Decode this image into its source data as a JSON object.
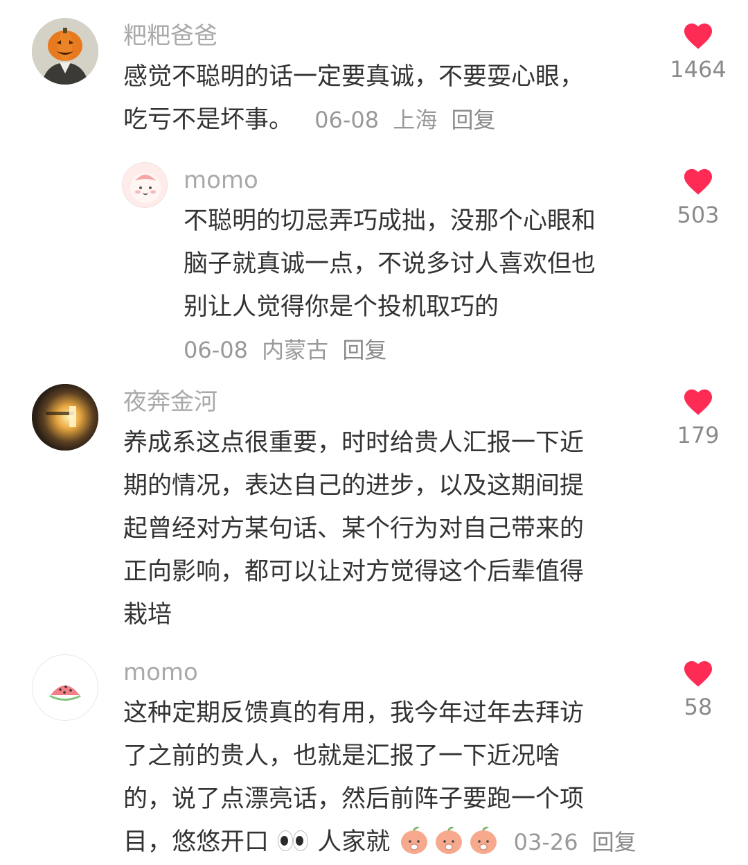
{
  "comments": [
    {
      "username": "粑粑爸爸",
      "text_lines": [
        "感觉不聪明的话一定要真诚，不要耍心眼，",
        "吃亏不是坏事。"
      ],
      "date": "06-08",
      "location": "上海",
      "reply_label": "回复",
      "likes": "1464",
      "avatar_icon": "pumpkin-head-avatar"
    },
    {
      "username": "momo",
      "text_lines": [
        "不聪明的切忌弄巧成拙，没那个心眼和",
        "脑子就真诚一点，不说多讨人喜欢但也",
        "别让人觉得你是个投机取巧的"
      ],
      "date": "06-08",
      "location": "内蒙古",
      "reply_label": "回复",
      "likes": "503",
      "avatar_icon": "pink-blob-avatar"
    },
    {
      "username": "夜奔金河",
      "text_lines": [
        "养成系这点很重要，时时给贵人汇报一下近",
        "期的情况，表达自己的进步，以及这期间提",
        "起曾经对方某句话、某个行为对自己带来的",
        "正向影响，都可以让对方觉得这个后辈值得",
        "栽培"
      ],
      "likes": "179",
      "avatar_icon": "lamp-photo-avatar"
    },
    {
      "username": "momo",
      "text_lines": [
        "这种定期反馈真的有用，我今年过年去拜访",
        "了之前的贵人，也就是汇报了一下近况啥",
        "的，说了点漂亮话，然后前阵子要跑一个项"
      ],
      "last_line": "目，悠悠开口",
      "last_line_2": "人家就",
      "date": "03-26",
      "reply_label": "回复",
      "likes": "58",
      "avatar_icon": "watermelon-avatar"
    }
  ],
  "colors": {
    "like_heart": "#fe2c55",
    "username": "#a9a9a9",
    "text": "#333333",
    "meta": "#999999"
  }
}
